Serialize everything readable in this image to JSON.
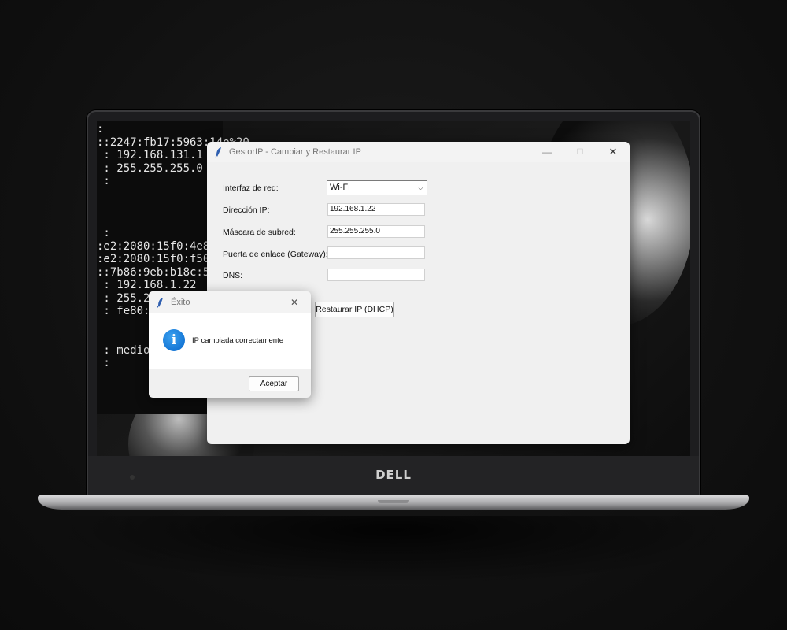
{
  "laptop": {
    "brand": "DELL"
  },
  "terminal": {
    "lines": [
      ":",
      "::2247:fb17:5963:14e%20",
      " : 192.168.131.1",
      " : 255.255.255.0",
      " :",
      "",
      "",
      "",
      " :",
      ":e2:2080:15f0:4e8",
      ":e2:2080:15f0:f50",
      "::7b86:9eb:b18c:5",
      " : 192.168.1.22",
      " : 255.2",
      " : fe80:",
      "",
      "",
      " : medio",
      " :"
    ]
  },
  "main_window": {
    "title": "GestorIP - Cambiar y Restaurar IP",
    "labels": {
      "interface": "Interfaz de red:",
      "ip": "Dirección IP:",
      "mask": "Máscara de subred:",
      "gateway": "Puerta de enlace (Gateway):",
      "dns": "DNS:"
    },
    "values": {
      "interface": "Wi-Fi",
      "ip": "192.168.1.22",
      "mask": "255.255.255.0",
      "gateway": "",
      "dns": ""
    },
    "restore_button": "Restaurar IP (DHCP)",
    "controls": {
      "minimize": "—",
      "maximize": "☐",
      "close": "✕"
    }
  },
  "dialog": {
    "title": "Éxito",
    "message": "IP cambiada correctamente",
    "ok_button": "Aceptar",
    "close": "✕",
    "icon": "info-icon",
    "icon_glyph": "i"
  },
  "colors": {
    "info_blue": "#1677d6",
    "window_bg": "#f0f0f0"
  }
}
